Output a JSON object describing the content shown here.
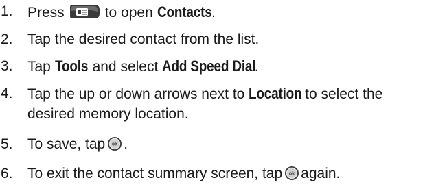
{
  "steps": [
    {
      "number": "1.",
      "before": "Press",
      "icon": "contacts-key-icon",
      "middle": "to open",
      "bold": "Contacts",
      "after": "."
    },
    {
      "number": "2.",
      "text": "Tap the desired contact from the list."
    },
    {
      "number": "3.",
      "before": "Tap",
      "bold1": "Tools",
      "middle": "and select",
      "bold2": "Add Speed Dial",
      "after": "."
    },
    {
      "number": "4.",
      "before": "Tap the up or down arrows next to",
      "bold": "Location",
      "after": "to select the",
      "line2": "desired memory location."
    },
    {
      "number": "5.",
      "before": "To save, tap",
      "icon": "ok-button-icon",
      "icon_label": "ok",
      "after": "."
    },
    {
      "number": "6.",
      "before": "To exit the contact summary screen, tap",
      "icon": "ok-button-icon",
      "icon_label": "ok",
      "after": "again."
    }
  ],
  "colors": {
    "text": "#1a1a1a",
    "icon_dark": "#3a3a3a",
    "icon_light": "#e8e8e8"
  }
}
